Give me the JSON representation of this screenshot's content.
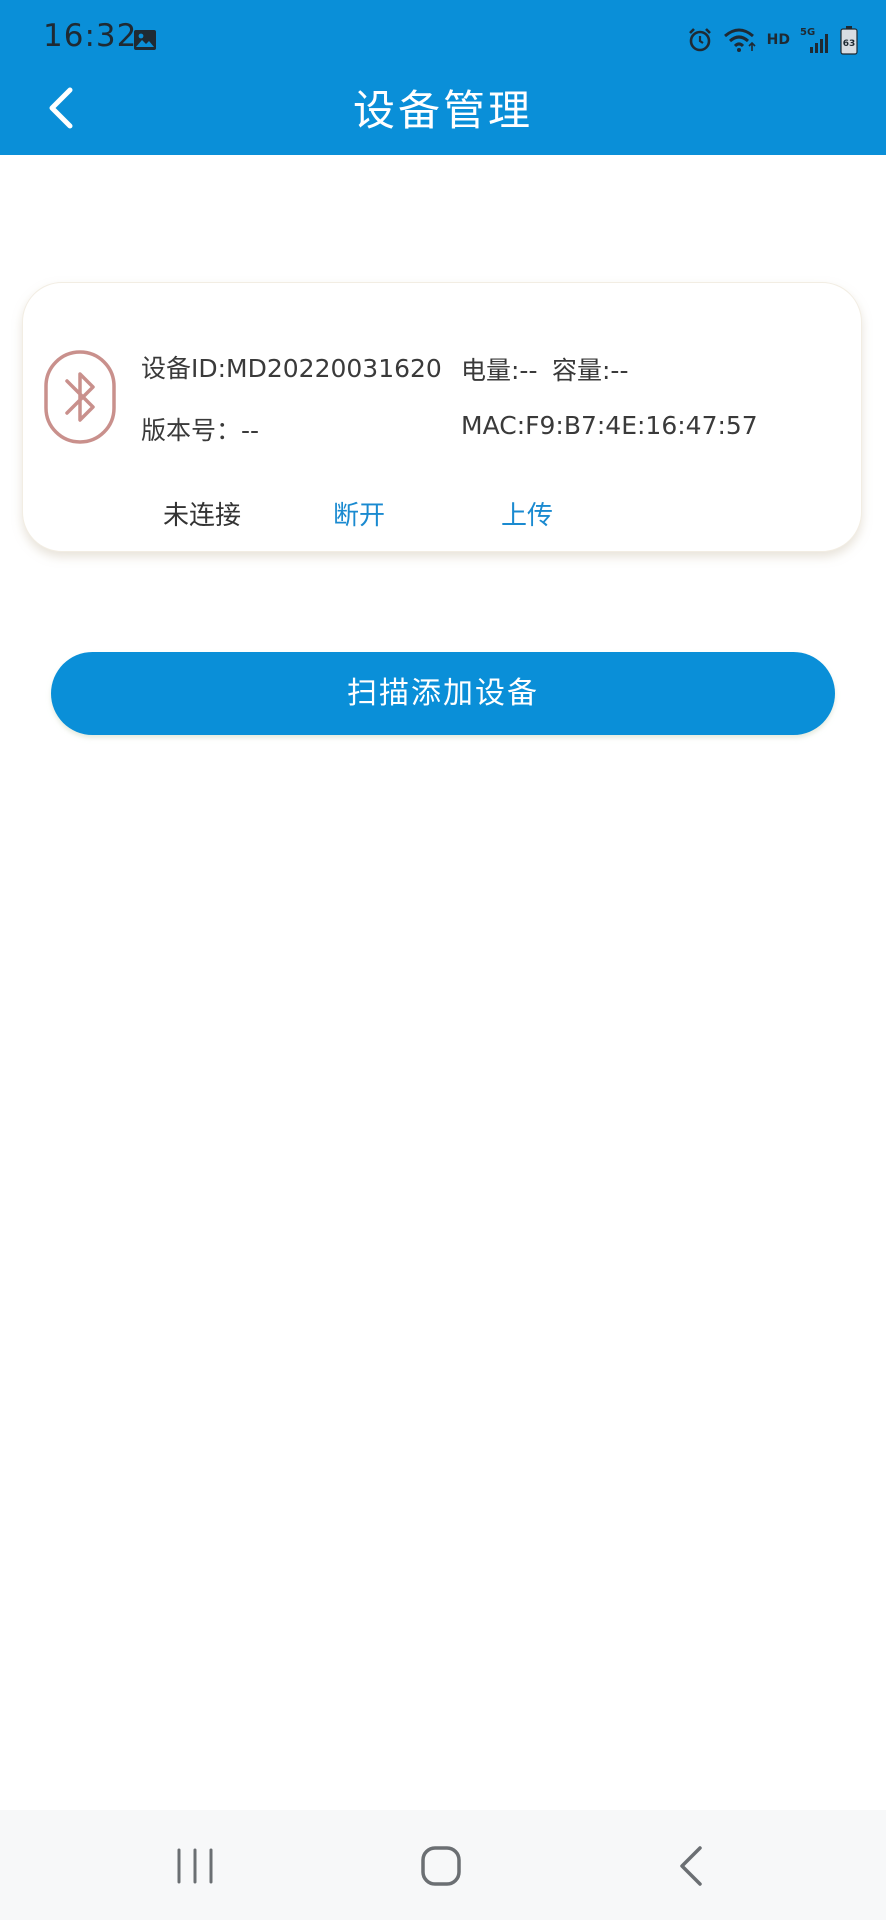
{
  "status_bar": {
    "time": "16:32",
    "hd_label": "HD",
    "network_label": "5G",
    "battery": "63"
  },
  "header": {
    "title": "设备管理"
  },
  "device_card": {
    "device_id": "设备ID:MD20220031620",
    "power": "电量:--",
    "capacity": "容量:--",
    "version": "版本号：--",
    "mac": "MAC:F9:B7:4E:16:47:57",
    "connection_status": "未连接",
    "disconnect_label": "断开",
    "upload_label": "上传"
  },
  "scan_button": {
    "label": "扫描添加设备"
  },
  "colors": {
    "brand": "#0a8fd8",
    "link": "#1a8ad0",
    "bluetooth_icon": "#c9908c"
  },
  "icons": {
    "header": "back-chevron",
    "device": "bluetooth",
    "nav": [
      "recent-apps",
      "home",
      "back"
    ]
  }
}
